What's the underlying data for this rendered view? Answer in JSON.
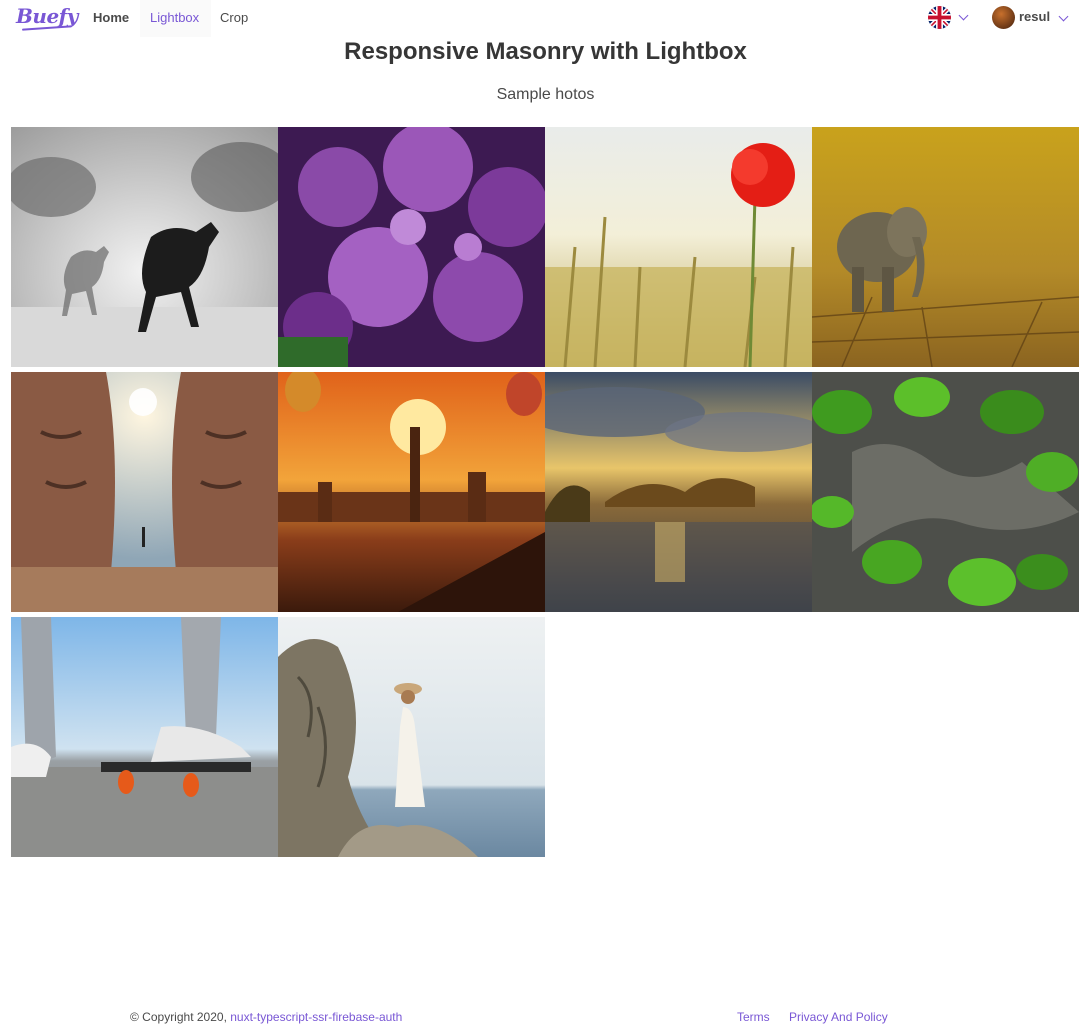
{
  "navbar": {
    "brand": "Buefy",
    "items": [
      {
        "label": "Home"
      },
      {
        "label": "Lightbox"
      },
      {
        "label": "Crop"
      }
    ],
    "user": {
      "name": "resul"
    },
    "language": {
      "icon": "uk-flag-icon"
    }
  },
  "page": {
    "title": "Responsive Masonry with Lightbox",
    "subtitle": "Sample hotos"
  },
  "gallery": {
    "photos": [
      {
        "subject": "horses-running-fog"
      },
      {
        "subject": "purple-lilac-flowers"
      },
      {
        "subject": "red-poppy-wheat-field"
      },
      {
        "subject": "elephant-cracked-earth"
      },
      {
        "subject": "stone-faces-sun"
      },
      {
        "subject": "city-sunset-balloons"
      },
      {
        "subject": "lake-sunset"
      },
      {
        "subject": "green-ivy-leaves"
      },
      {
        "subject": "sneakers-skateboard"
      },
      {
        "subject": "woman-rocks-sea"
      }
    ]
  },
  "footer": {
    "copyright_prefix": "© Copyright 2020, ",
    "copyright_link": "nuxt-typescript-ssr-firebase-auth",
    "links": [
      {
        "label": "Terms"
      },
      {
        "label": "Privacy And Policy"
      }
    ]
  },
  "colors": {
    "primary": "#7957d5",
    "text": "#4a4a4a",
    "heading": "#363636"
  }
}
